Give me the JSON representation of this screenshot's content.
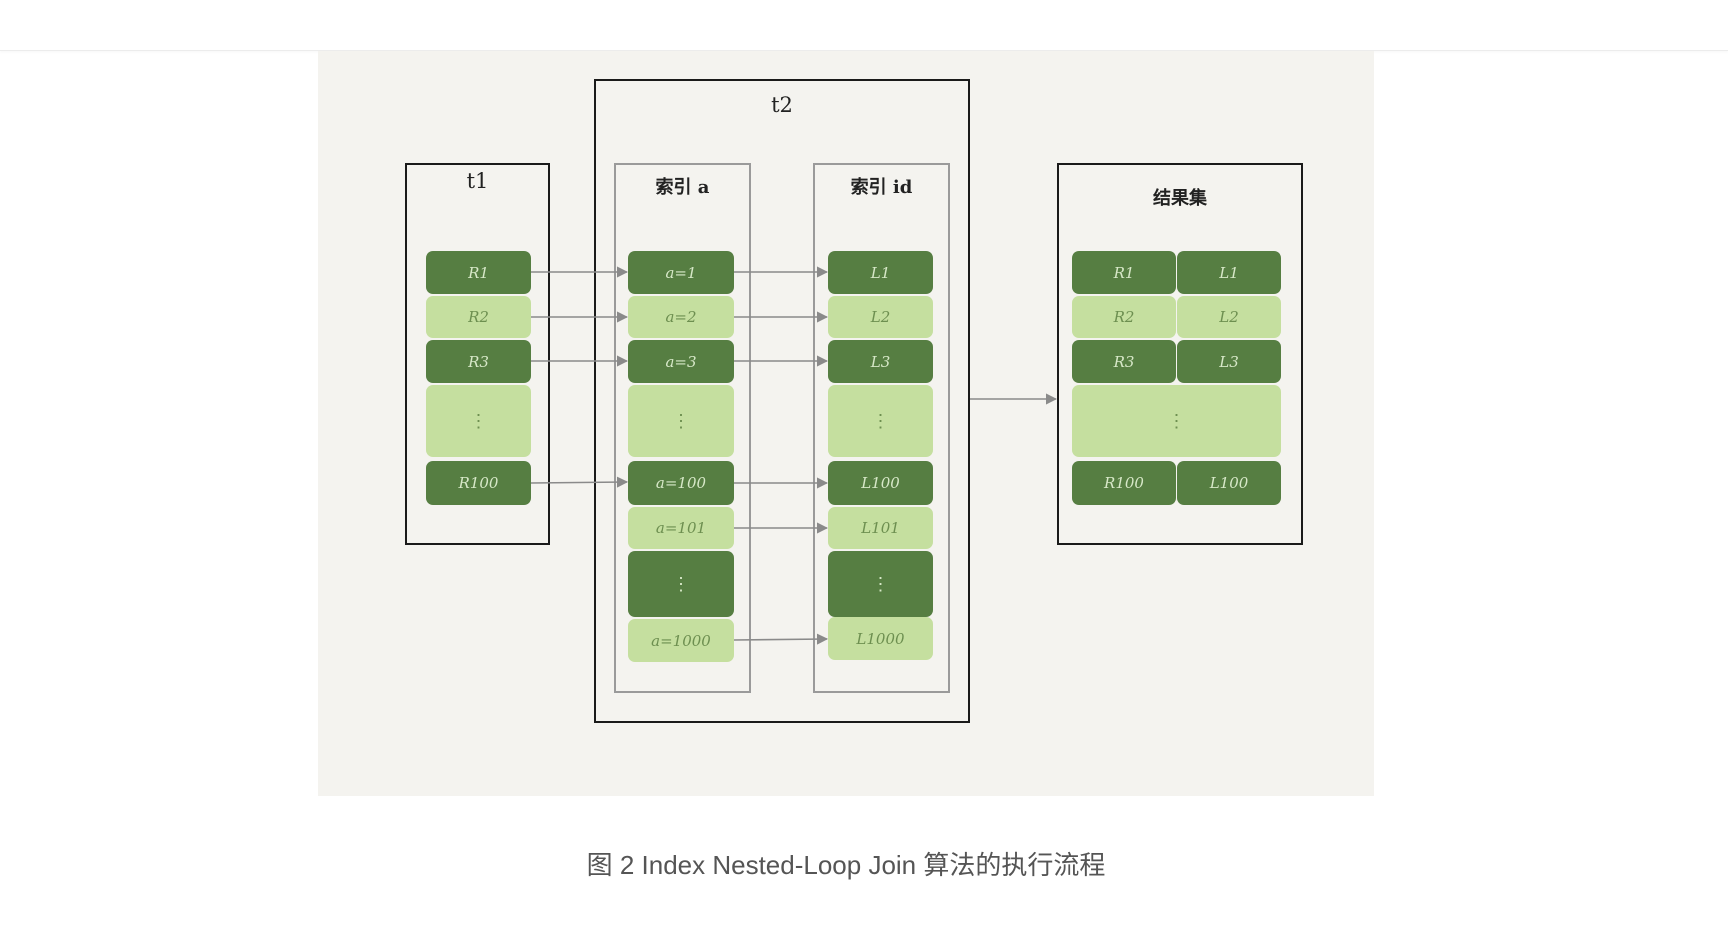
{
  "figure": {
    "t2_title": "t2",
    "t1_title": "t1",
    "index_a_title": "索引 a",
    "index_id_title": "索引 id",
    "result_title": "结果集",
    "ellipsis": "⋮",
    "t1_rows": [
      "R1",
      "R2",
      "R3",
      "R100"
    ],
    "index_a_rows": [
      "a=1",
      "a=2",
      "a=3",
      "a=100",
      "a=101",
      "a=1000"
    ],
    "index_id_rows": [
      "L1",
      "L2",
      "L3",
      "L100",
      "L101",
      "L1000"
    ],
    "result_rows": [
      [
        "R1",
        "L1"
      ],
      [
        "R2",
        "L2"
      ],
      [
        "R3",
        "L3"
      ],
      [
        "R100",
        "L100"
      ]
    ],
    "colors": {
      "dark_green": "#567e42",
      "light_green": "#c5df9f",
      "background": "#f4f3ef",
      "arrow": "#8a8a8a"
    }
  },
  "caption": "图 2 Index Nested-Loop Join 算法的执行流程"
}
